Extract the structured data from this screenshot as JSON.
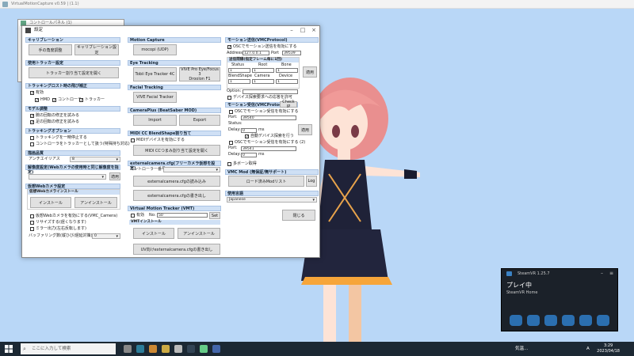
{
  "app": {
    "title": "VirtualMotionCapture v0.59 | (1.1)"
  },
  "control_panel": {
    "title": "コントロールパネル (1)"
  },
  "settings": {
    "title": "設定",
    "calibration": {
      "header": "キャリブレーション",
      "manual_btn": "手の角度調整",
      "calib_btn": "キャリブレーション設定"
    },
    "tracker_assign": {
      "header": "使用トラッカー設定",
      "open_btn": "トラッカー割り当て設定を開く"
    },
    "lost_tracking": {
      "header": "トラッキングロスト時の飛び補正",
      "enable": "有効",
      "hmd": "HMD",
      "controller": "コントローラ",
      "tracker": "トラッカー"
    },
    "model_adjust": {
      "header": "モデル調整",
      "elbow": "腕の回転の修正を試みる",
      "knee": "足の回転の修正を試みる"
    },
    "tracking_option": {
      "header": "トラッキングオプション",
      "pause": "トラッキングを一時停止する",
      "controller_tracker": "コントローラをトラッカーとして扱う(特殊持ち対応)"
    },
    "render": {
      "header": "描画品質",
      "aa_label": "アンチエイリアス",
      "aa_value": "8"
    },
    "webcam_res": {
      "header": "解像度設定(Webカメラの使用時と同じ解像度を指定)",
      "apply": "適用"
    },
    "virtual_cam": {
      "header": "仮想Webカメラ設定",
      "install_header": "仮想Webカメラインストール",
      "install": "インストール",
      "uninstall": "アンインストール",
      "use_vc": "仮想Webカメラを有効にする(VMC_Camera)",
      "resize": "リサイズする(遅くなります)",
      "mirror": "ミラー出力(左右反転します)",
      "buffering_label": "バッファリング数(縦ひび/遅延対策)：",
      "buffering_value": "0"
    },
    "motion_capture": {
      "header": "Motion Capture",
      "mocopi": "mocopi (UDP)"
    },
    "eye_tracking": {
      "header": "Eye Tracking",
      "tobii": "Tobii Eye Tracker 4C",
      "vive_pro": "VIVE Pro Eye/Focus 3\nDroolon F1"
    },
    "facial_tracking": {
      "header": "Facial Tracking",
      "vive_facial": "VIVE Facial Tracker"
    },
    "cameraplus": {
      "header": "CameraPlus (BeatSaber MOD)",
      "import": "Import",
      "export": "Export"
    },
    "midi": {
      "header": "MIDI CC BlendShape割り当て",
      "enable": "MIDIデバイスを有効にする",
      "open_btn": "MIDI CCつまみ割り当て設定を開く"
    },
    "external_camera": {
      "header": "externalcamera.cfg(フリーカメラ仮想を設定)",
      "controller_label": "コントローラー番号：",
      "load": "externalcamera.cfgの読み込み",
      "save": "externalcamera.cfgの書き出し"
    },
    "vmt": {
      "header": "Virtual Motion Tracker (VMT)",
      "enable": "有効",
      "no_label": "No:",
      "no_value": "50",
      "set": "Set",
      "install_header": "VMTインストール",
      "install": "インストール",
      "uninstall": "アンインストール",
      "uv_btn": "UV向けexternalcamera.cfgの書き出し"
    },
    "vmc_send": {
      "header": "モーション送信(VMCProtocol)",
      "enable": "OSCでモーション送信を有効にする",
      "address_label": "Address",
      "address_value": "127.0.0.1",
      "port_label": "Port",
      "port_value": "39539",
      "interval_header": "送信間隔(指定フレーム毎に1回)",
      "cols": [
        "Status",
        "Root",
        "Bone"
      ],
      "row1": [
        "1",
        "1",
        "1"
      ],
      "cols2": [
        "BlendShape",
        "Camera",
        "Device"
      ],
      "row2": [
        "1",
        "1",
        "1"
      ],
      "option_label": "Option:",
      "device_check": "デバイス探索要求への応答を許可",
      "apply": "適用"
    },
    "vmc_receive": {
      "header": "モーション受信(VMCProtocol) ※",
      "check_ip": "Check IP",
      "enable1": "OSCでモーション受信を有効にする",
      "port_label": "Port:",
      "port1": "39540",
      "status_label": "Status:",
      "delay_label": "Delay:",
      "delay1": "0",
      "ms": "ms",
      "auto_device": "自動デバイス探索を行う",
      "enable2": "OSCでモーション受信を有効にする (2)",
      "port2": "39541",
      "delay2": "0",
      "apply": "適用",
      "multi_bone": "多ボーン取得"
    },
    "vmc_mod": {
      "header": "VMC Mod (無保証/無サポート)",
      "loaded": "ロード済みModリスト",
      "log": "Log"
    },
    "language": {
      "header": "使用言語",
      "value": "Japanese"
    },
    "close": "閉じる"
  },
  "steamvr": {
    "title": "SteamVR 1.25.7",
    "status": "プレイ中",
    "home": "SteamVR Home"
  },
  "taskbar": {
    "search_placeholder": "ここに入力して検索",
    "weather": "気温...",
    "lang": "A",
    "time": "3:29",
    "date": "2023/04/18"
  }
}
